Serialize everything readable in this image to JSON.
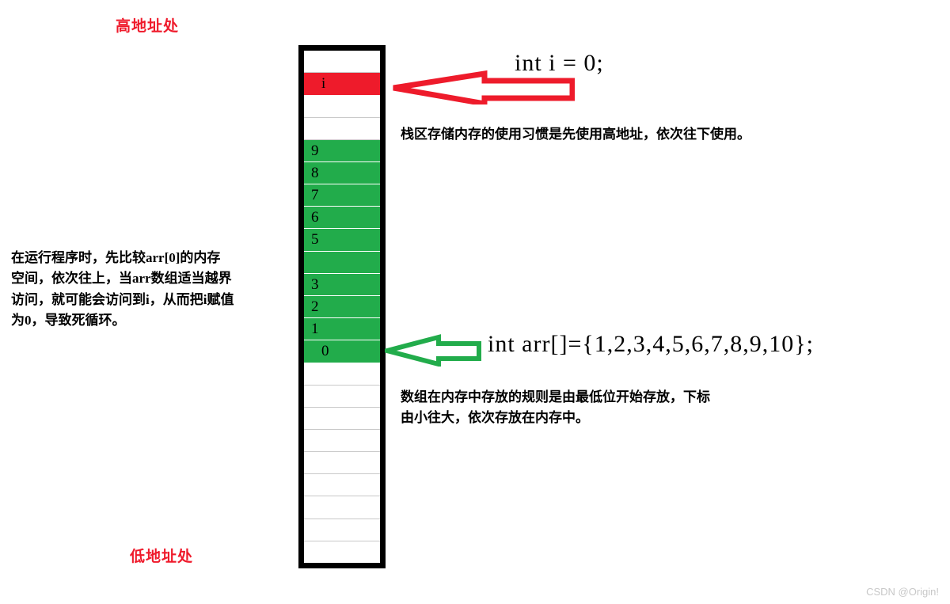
{
  "labels": {
    "high_address": "高地址处",
    "low_address": "低地址处",
    "address_color": "#ef1a2b"
  },
  "memory": {
    "border_color": "#000000",
    "red_color": "#ee1b2b",
    "green_color": "#22ac4b",
    "cells": [
      {
        "text": "",
        "fill": "white"
      },
      {
        "text": "i",
        "fill": "red"
      },
      {
        "text": "",
        "fill": "white"
      },
      {
        "text": "",
        "fill": "white"
      },
      {
        "text": "9",
        "fill": "green"
      },
      {
        "text": "8",
        "fill": "green"
      },
      {
        "text": "7",
        "fill": "green"
      },
      {
        "text": "6",
        "fill": "green"
      },
      {
        "text": "5",
        "fill": "green"
      },
      {
        "text": "",
        "fill": "green"
      },
      {
        "text": "3",
        "fill": "green"
      },
      {
        "text": "2",
        "fill": "green"
      },
      {
        "text": "1",
        "fill": "green"
      },
      {
        "text": "0",
        "fill": "green"
      },
      {
        "text": "",
        "fill": "white"
      },
      {
        "text": "",
        "fill": "white"
      },
      {
        "text": "",
        "fill": "white"
      },
      {
        "text": "",
        "fill": "white"
      },
      {
        "text": "",
        "fill": "white"
      },
      {
        "text": "",
        "fill": "white"
      },
      {
        "text": "",
        "fill": "white"
      },
      {
        "text": "",
        "fill": "white"
      },
      {
        "text": "",
        "fill": "white"
      }
    ]
  },
  "annotations": {
    "code_int_i": "int i = 0;",
    "code_array": "int arr[]={1,2,3,4,5,6,7,8,9,10};",
    "note_stack": "栈区存储内存的使用习惯是先使用高地址，依次往下使用。",
    "note_array": "数组在内存中存放的规则是由最低位开始存放，下标\n由小往大，依次存放在内存中。",
    "note_left": "在运行程序时，先比较arr[0]的内存\n空间，依次往上，当arr数组适当越界\n访问，就可能会访问到i，从而把i赋值\n为0，导致死循环。"
  },
  "arrows": {
    "red_arrow_color": "#ee1b2b",
    "green_arrow_color": "#22ac4b"
  },
  "watermark": "CSDN @Origin!"
}
